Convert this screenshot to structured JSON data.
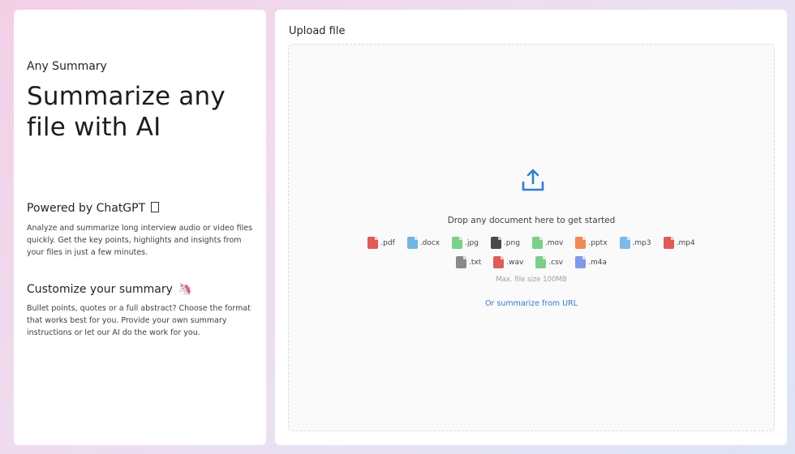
{
  "left": {
    "app_name": "Any Summary",
    "headline": "Summarize any file with AI",
    "powered_title": "Powered by ChatGPT",
    "powered_text": "Analyze and summarize long interview audio or video files quickly. Get the key points, highlights and insights from your files in just a few minutes.",
    "customize_title": "Customize your summary",
    "customize_emoji": "🦄",
    "customize_text": "Bullet points, quotes or a full abstract? Choose the format that works best for you. Provide your own summary instructions or let our AI do the work for you."
  },
  "upload": {
    "title": "Upload file",
    "drop_text": "Drop any document here to get started",
    "file_types_row1": [
      {
        "ext": ".pdf",
        "color": "#e05a5a",
        "icon": "pdf-file-icon"
      },
      {
        "ext": ".docx",
        "color": "#6fb6e6",
        "icon": "docx-file-icon"
      },
      {
        "ext": ".jpg",
        "color": "#7ccf8b",
        "icon": "jpg-file-icon"
      },
      {
        "ext": ".png",
        "color": "#4a4a4a",
        "icon": "png-file-icon"
      },
      {
        "ext": ".mov",
        "color": "#7ccf8b",
        "icon": "mov-file-icon"
      },
      {
        "ext": ".pptx",
        "color": "#f08a55",
        "icon": "pptx-file-icon"
      },
      {
        "ext": ".mp3",
        "color": "#7fb9e8",
        "icon": "mp3-file-icon"
      },
      {
        "ext": ".mp4",
        "color": "#e05a5a",
        "icon": "mp4-file-icon"
      }
    ],
    "file_types_row2": [
      {
        "ext": ".txt",
        "color": "#8a8a8a",
        "icon": "txt-file-icon"
      },
      {
        "ext": ".wav",
        "color": "#e05a5a",
        "icon": "wav-file-icon"
      },
      {
        "ext": ".csv",
        "color": "#7ccf8b",
        "icon": "csv-file-icon"
      },
      {
        "ext": ".m4a",
        "color": "#7f9be8",
        "icon": "m4a-file-icon"
      }
    ],
    "max_size": "Max. file size 100MB",
    "url_link": "Or summarize from URL",
    "accent_color": "#2e7fd1"
  }
}
